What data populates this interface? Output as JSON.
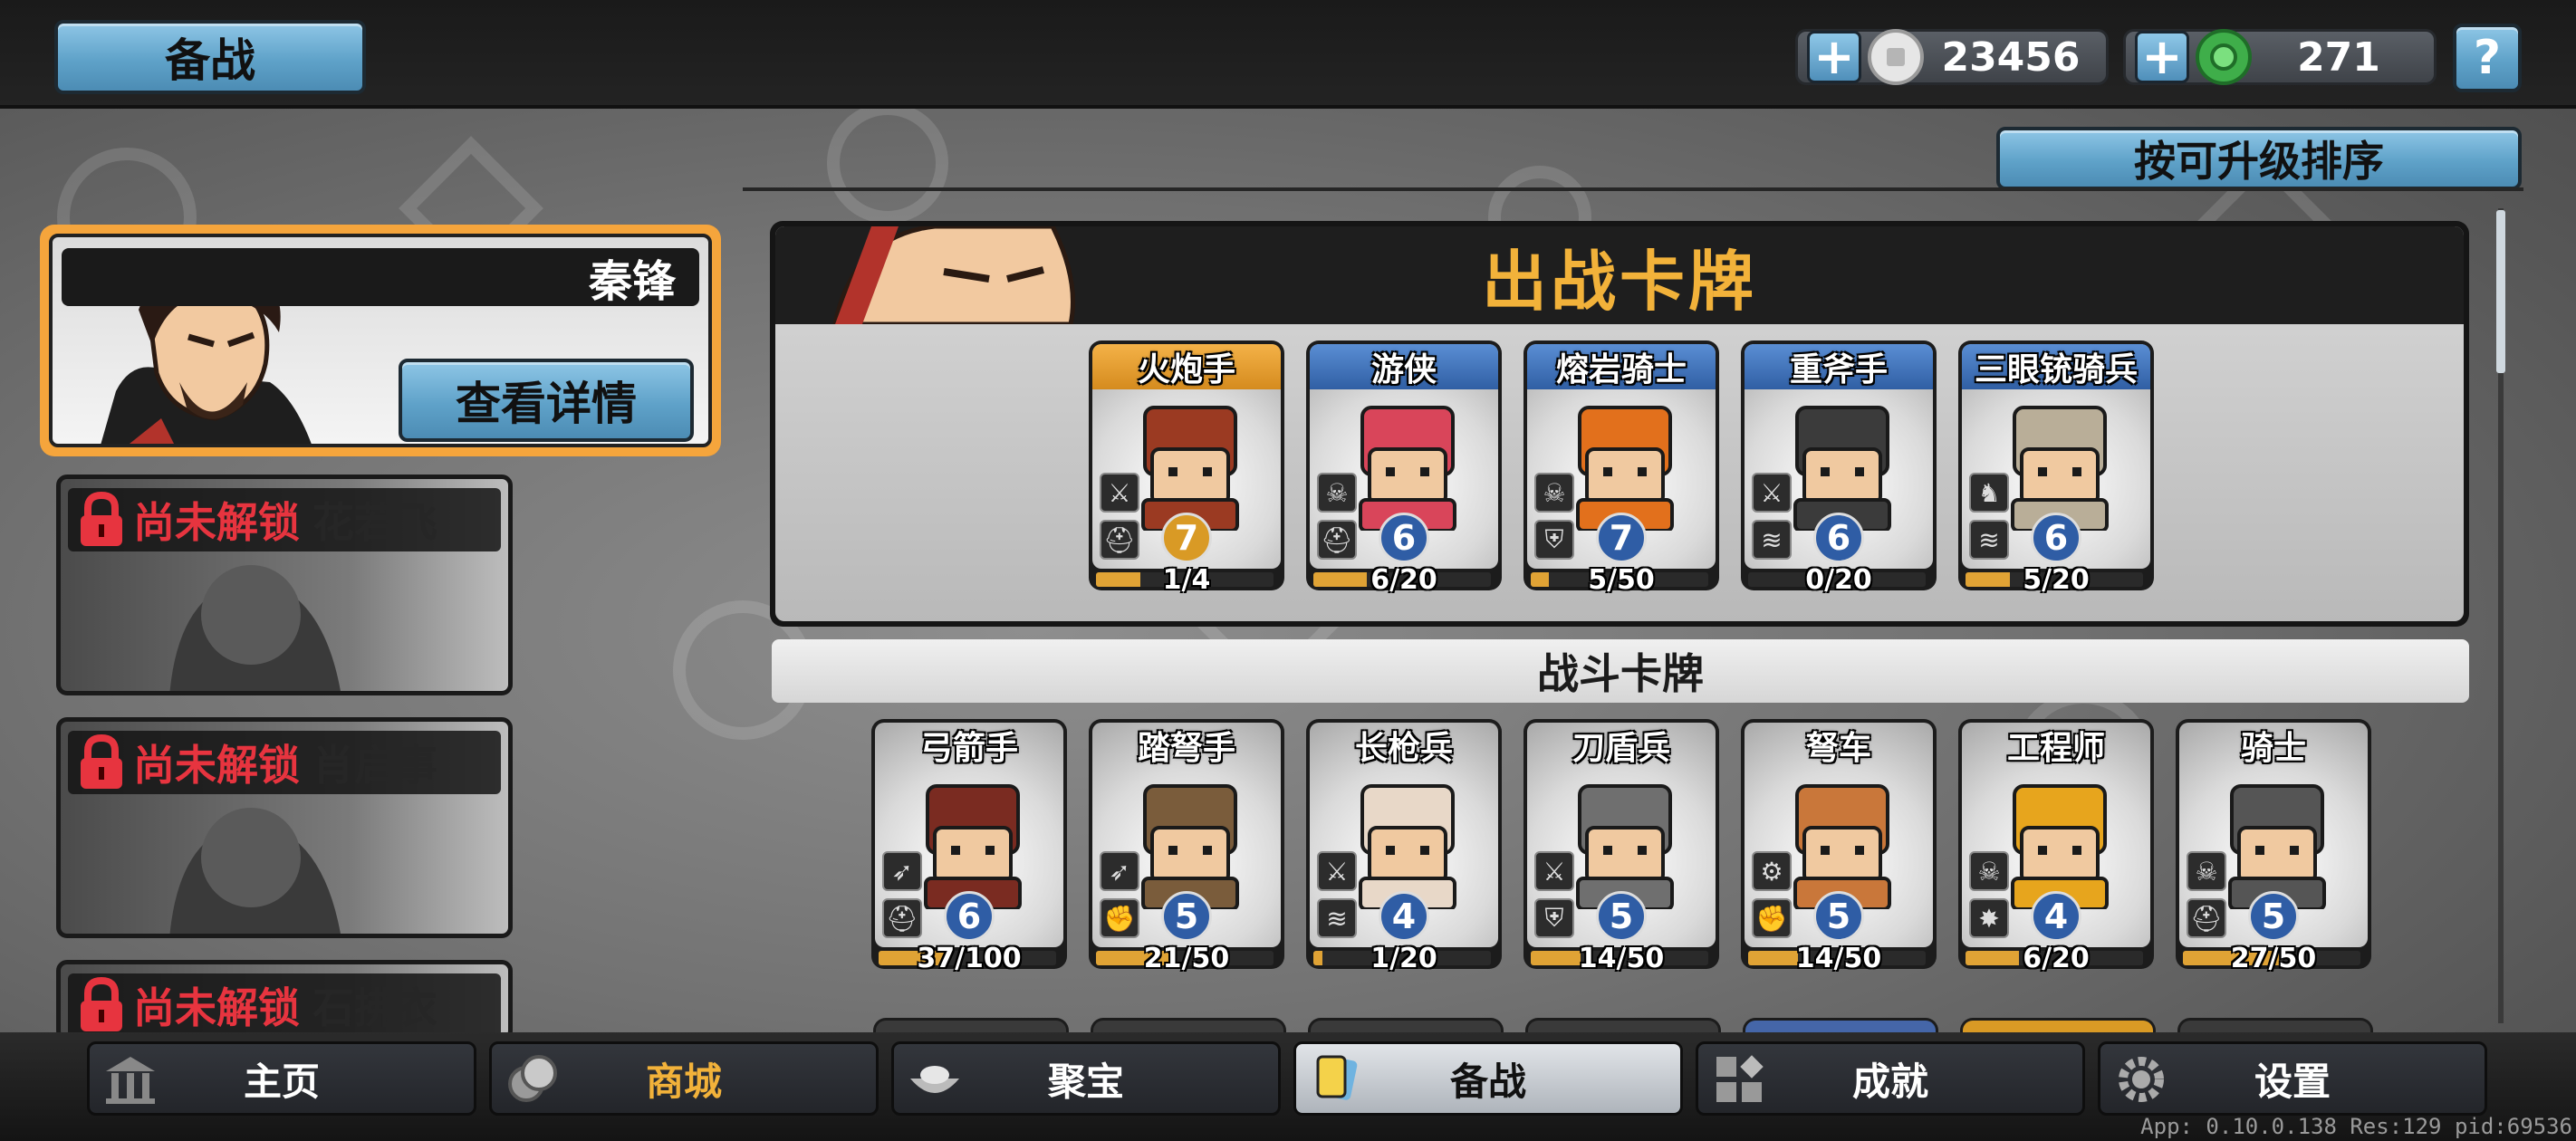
{
  "header": {
    "title": "备战",
    "silver": "23456",
    "gems": "271",
    "help_label": "?"
  },
  "sort_button": "按可升级排序",
  "heroes": {
    "selected": {
      "name": "秦锋",
      "detail_label": "查看详情"
    },
    "locked": [
      {
        "status": "尚未解锁",
        "name": "花若飞"
      },
      {
        "status": "尚未解锁",
        "name": "肖启事"
      },
      {
        "status": "尚未解锁",
        "name": "石拂衣"
      }
    ]
  },
  "battle_section": {
    "title": "出战卡牌",
    "cards": [
      {
        "name": "火炮手",
        "level": "7",
        "progress": "1/4",
        "ratio": 0.25,
        "header": "orange",
        "level_color": "gold",
        "art": "#9b3a22",
        "badges": [
          "sword-icon",
          "helmet-icon"
        ]
      },
      {
        "name": "游侠",
        "level": "6",
        "progress": "6/20",
        "ratio": 0.3,
        "header": "blue",
        "level_color": "blue",
        "art": "#d9455a",
        "badges": [
          "skull-icon",
          "helmet-icon"
        ]
      },
      {
        "name": "熔岩骑士",
        "level": "7",
        "progress": "5/50",
        "ratio": 0.1,
        "header": "blue",
        "level_color": "blue",
        "art": "#e2701c",
        "badges": [
          "skull-icon",
          "shield-icon"
        ]
      },
      {
        "name": "重斧手",
        "level": "6",
        "progress": "0/20",
        "ratio": 0.0,
        "header": "blue",
        "level_color": "blue",
        "art": "#3b3b3b",
        "badges": [
          "sword-icon",
          "wind-icon"
        ]
      },
      {
        "name": "三眼铳骑兵",
        "level": "6",
        "progress": "5/20",
        "ratio": 0.25,
        "header": "blue",
        "level_color": "blue",
        "art": "#b9ae98",
        "badges": [
          "horse-icon",
          "wind-icon"
        ]
      }
    ]
  },
  "combat_section": {
    "title": "战斗卡牌",
    "cards": [
      {
        "name": "弓箭手",
        "level": "6",
        "progress": "37/100",
        "ratio": 0.37,
        "art": "#7a2b21",
        "badges": [
          "arrow-icon",
          "helmet-icon"
        ]
      },
      {
        "name": "踏弩手",
        "level": "5",
        "progress": "21/50",
        "ratio": 0.42,
        "art": "#7a5c3b",
        "badges": [
          "arrow-icon",
          "fist-icon"
        ]
      },
      {
        "name": "长枪兵",
        "level": "4",
        "progress": "1/20",
        "ratio": 0.05,
        "art": "#e8d8c8",
        "badges": [
          "sword-icon",
          "wind-icon"
        ]
      },
      {
        "name": "刀盾兵",
        "level": "5",
        "progress": "14/50",
        "ratio": 0.28,
        "art": "#6f6f6f",
        "badges": [
          "sword-icon",
          "shield-icon"
        ]
      },
      {
        "name": "弩车",
        "level": "5",
        "progress": "14/50",
        "ratio": 0.28,
        "art": "#c9773a",
        "badges": [
          "gear-icon",
          "fist-icon"
        ]
      },
      {
        "name": "工程师",
        "level": "4",
        "progress": "6/20",
        "ratio": 0.3,
        "art": "#e7a51d",
        "badges": [
          "skull-icon",
          "burst-icon"
        ]
      },
      {
        "name": "骑士",
        "level": "5",
        "progress": "27/50",
        "ratio": 0.54,
        "art": "#555555",
        "badges": [
          "skull-icon",
          "helmet-icon"
        ]
      }
    ]
  },
  "nav": [
    {
      "label": "主页",
      "icon": "temple-icon",
      "active": false,
      "gold": false
    },
    {
      "label": "商城",
      "icon": "coins-icon",
      "active": false,
      "gold": true
    },
    {
      "label": "聚宝",
      "icon": "treasure-bowl-icon",
      "active": false,
      "gold": false
    },
    {
      "label": "备战",
      "icon": "cards-icon",
      "active": true,
      "gold": false
    },
    {
      "label": "成就",
      "icon": "achievement-icon",
      "active": false,
      "gold": false
    },
    {
      "label": "设置",
      "icon": "gear-icon",
      "active": false,
      "gold": false
    }
  ],
  "version": "App: 0.10.0.138 Res:129 pid:69536",
  "colors": {
    "accent_gold": "#f2b23a",
    "lock_red": "#e7343f",
    "button_blue": "#5fa2c9"
  }
}
